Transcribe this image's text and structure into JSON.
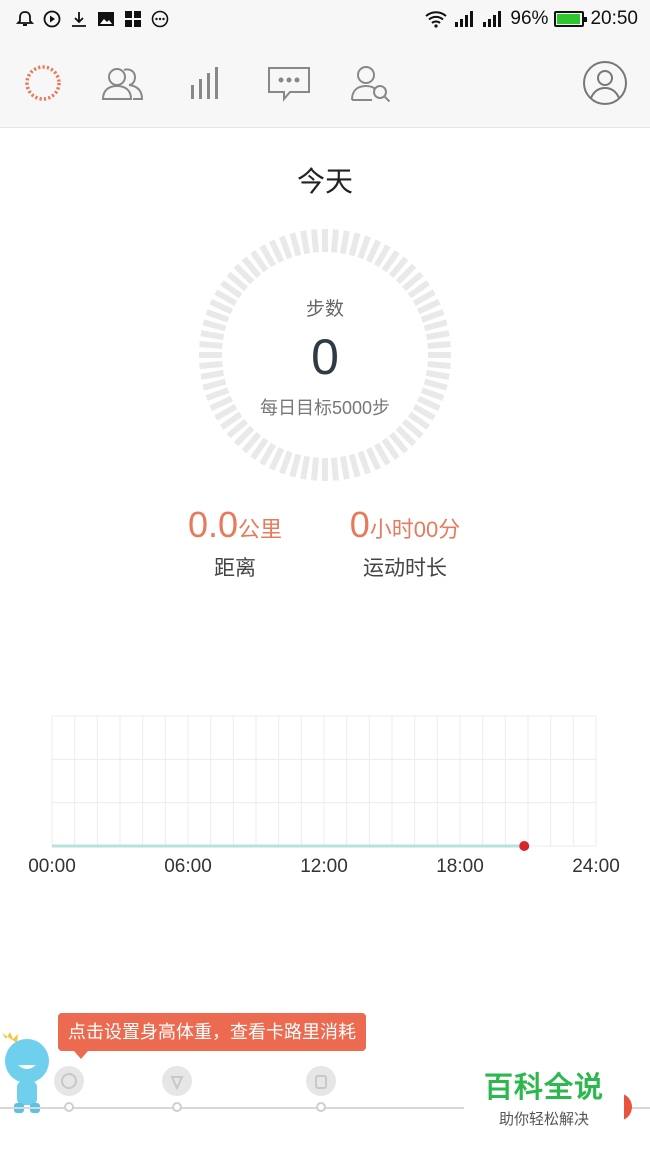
{
  "status_bar": {
    "icons_left": [
      "alarm-icon",
      "play-icon",
      "download-icon",
      "image-icon",
      "apps-icon",
      "more-icon"
    ],
    "battery_percent": "96%",
    "battery_level": 0.96,
    "time": "20:50",
    "icons_right": [
      "wifi-icon",
      "signal-icon",
      "signal-icon"
    ]
  },
  "nav": {
    "items": [
      "activity-ring-icon",
      "friends-icon",
      "stats-icon",
      "messages-icon",
      "find-friend-icon",
      "profile-icon"
    ],
    "active_color": "#e8795a"
  },
  "header": {
    "title": "今天"
  },
  "steps": {
    "label": "步数",
    "value": "0",
    "goal": "每日目标5000步",
    "progress": 0
  },
  "metrics": {
    "distance": {
      "value": "0.0",
      "unit": "公里",
      "label": "距离"
    },
    "duration": {
      "value": "0",
      "unit": "小时00分",
      "label": "运动时长"
    }
  },
  "chart_data": {
    "type": "line",
    "x": [
      "00:00",
      "06:00",
      "12:00",
      "18:00",
      "24:00"
    ],
    "series": [
      {
        "values": [
          0,
          0,
          0,
          0,
          0
        ]
      }
    ],
    "current_point": {
      "x": "20:50",
      "y": 0
    },
    "grid": true
  },
  "tip": {
    "text": "点击设置身高体重，查看卡路里消耗"
  },
  "watermark": {
    "title": "百科全说",
    "subtitle": "助你轻松解决"
  },
  "colors": {
    "accent": "#e8795a",
    "marker": "#d8262a",
    "tip": "#ec6a4f"
  }
}
